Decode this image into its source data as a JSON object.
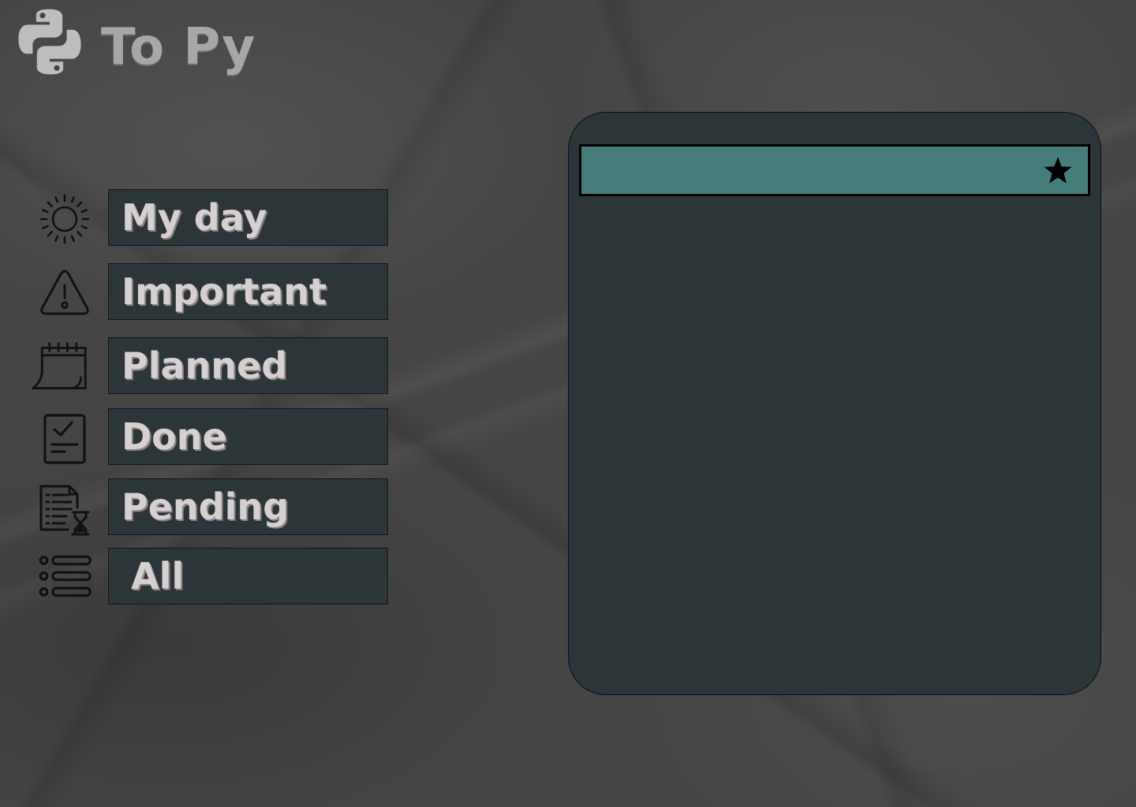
{
  "app": {
    "title": "To Py",
    "logo_icon": "python-logo-icon"
  },
  "sidebar": {
    "items": [
      {
        "label": "My day",
        "icon": "sun-icon"
      },
      {
        "label": "Important",
        "icon": "warning-icon"
      },
      {
        "label": "Planned",
        "icon": "calendar-icon"
      },
      {
        "label": "Done",
        "icon": "clipboard-check-icon"
      },
      {
        "label": "Pending",
        "icon": "document-hourglass-icon"
      },
      {
        "label": "All",
        "icon": "list-icon"
      }
    ]
  },
  "tasks": {
    "items": [
      {
        "text": "",
        "starred": true,
        "star_icon": "star-icon"
      }
    ]
  },
  "colors": {
    "background": "#454545",
    "panel": "#2c3538",
    "task_row": "#457d7a",
    "nav_text": "#d6d0d0",
    "title_text": "#a7a7a7"
  }
}
